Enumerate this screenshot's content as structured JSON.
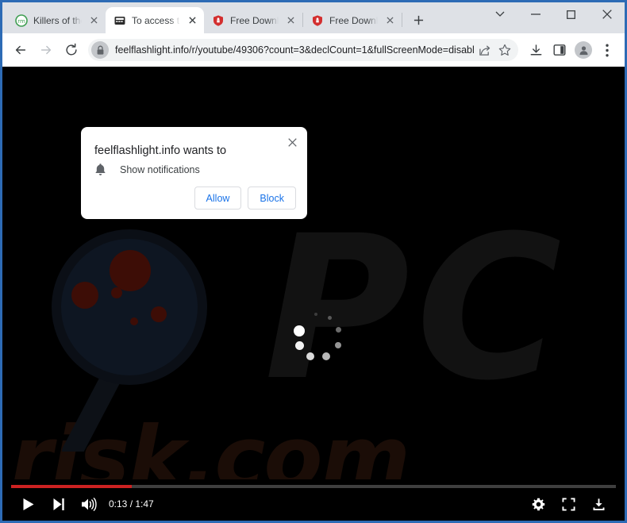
{
  "browser": {
    "tabs": [
      {
        "title": "Killers of the Flo",
        "favicon": "rm-circle-icon",
        "active": false
      },
      {
        "title": "To access the w",
        "favicon": "dark-square-icon",
        "active": true
      },
      {
        "title": "Free Download",
        "favicon": "red-shield-icon",
        "active": false
      },
      {
        "title": "Free Download",
        "favicon": "red-shield-icon",
        "active": false
      }
    ],
    "new_tab_label": "+",
    "window_controls": {
      "tab_search": "chevron-down-icon",
      "minimize": "minimize-icon",
      "maximize": "maximize-icon",
      "close": "close-icon"
    },
    "toolbar": {
      "back": "back-arrow-icon",
      "forward": "forward-arrow-icon",
      "reload": "reload-icon",
      "lock": "lock-icon",
      "url": "feelflashlight.info/r/youtube/49306?count=3&declCount=1&fullScreenMode=disabl...",
      "share": "share-icon",
      "bookmark": "star-icon",
      "downloads": "download-icon",
      "side_panel": "side-panel-icon",
      "profile": "profile-avatar-icon",
      "menu": "three-dot-menu-icon"
    }
  },
  "notification_dialog": {
    "title": "feelflashlight.info wants to",
    "permission_icon": "bell-icon",
    "permission_label": "Show notifications",
    "allow_label": "Allow",
    "block_label": "Block",
    "close_icon": "close-icon",
    "accent_color": "#1a73e8"
  },
  "video": {
    "watermark_top": "PC",
    "watermark_bottom": "risk.com",
    "loading_indicator": "loading-spinner",
    "progress_percent": 20,
    "progress_color": "#cc2222",
    "controls": {
      "play": "play-icon",
      "next": "next-track-icon",
      "volume": "volume-icon",
      "time": "0:13 / 1:47",
      "settings": "gear-icon",
      "fullscreen": "fullscreen-icon",
      "download": "download-icon"
    }
  }
}
